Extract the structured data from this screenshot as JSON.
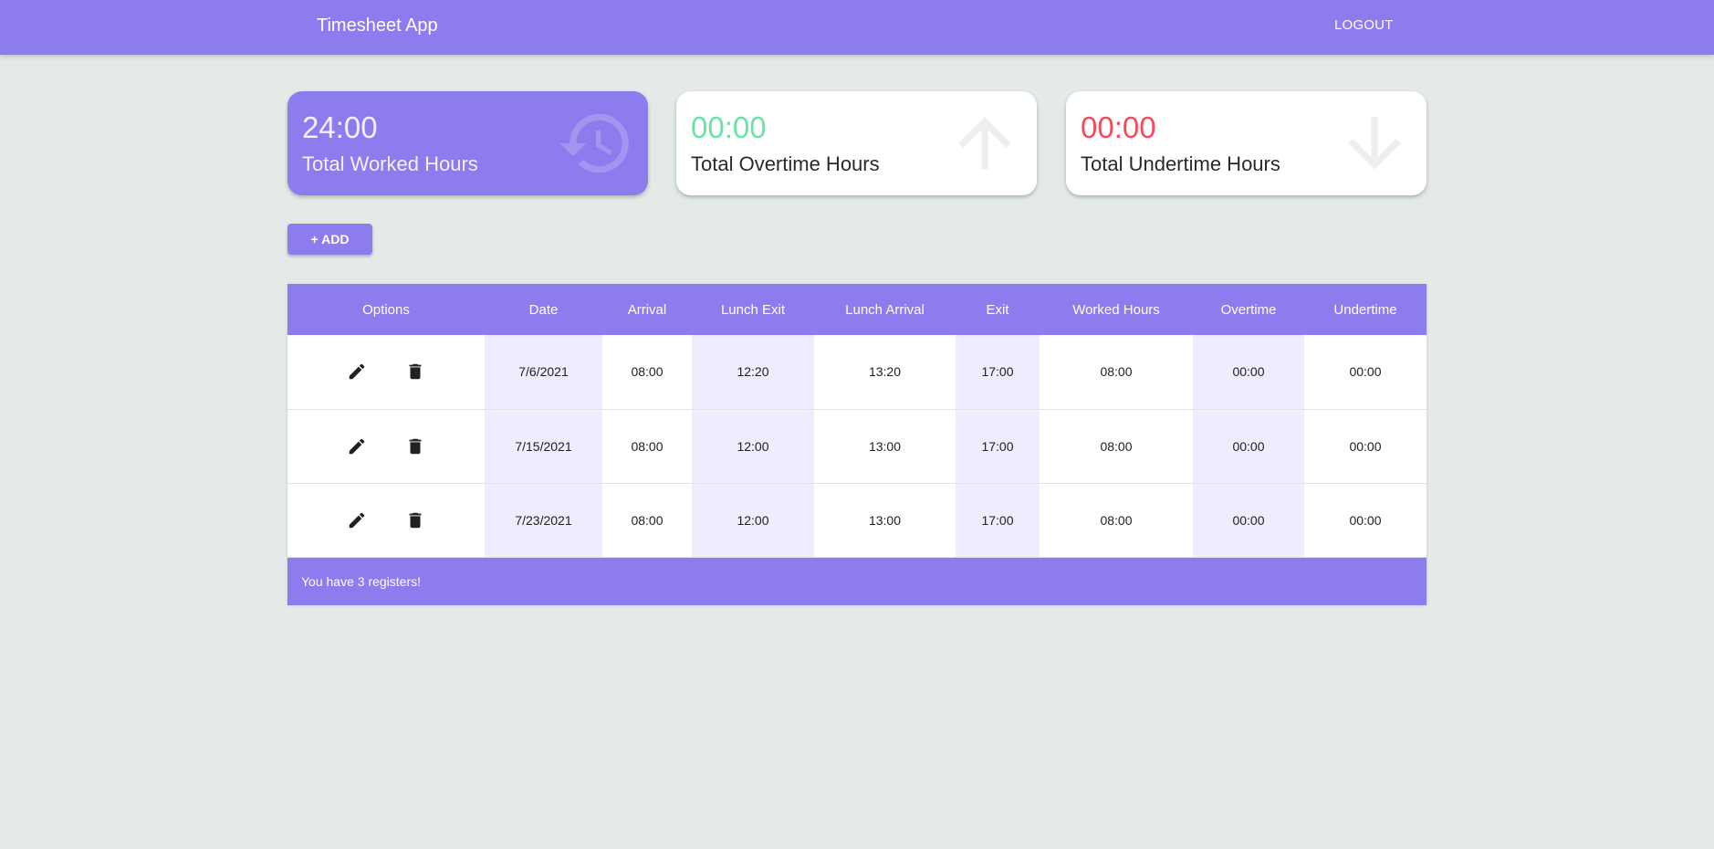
{
  "header": {
    "title": "Timesheet App",
    "logout_label": "LOGOUT"
  },
  "cards": {
    "worked": {
      "value": "24:00",
      "label": "Total Worked Hours",
      "icon": "history-icon"
    },
    "overtime": {
      "value": "00:00",
      "label": "Total Overtime Hours",
      "icon": "arrow-up-icon"
    },
    "undertime": {
      "value": "00:00",
      "label": "Total Undertime Hours",
      "icon": "arrow-down-icon"
    }
  },
  "add_button": {
    "label": "+ ADD"
  },
  "table": {
    "headers": [
      "Options",
      "Date",
      "Arrival",
      "Lunch Exit",
      "Lunch Arrival",
      "Exit",
      "Worked Hours",
      "Overtime",
      "Undertime"
    ],
    "rows": [
      {
        "date": "7/6/2021",
        "arrival": "08:00",
        "lunch_exit": "12:20",
        "lunch_arrival": "13:20",
        "exit": "17:00",
        "worked": "08:00",
        "overtime": "00:00",
        "undertime": "00:00"
      },
      {
        "date": "7/15/2021",
        "arrival": "08:00",
        "lunch_exit": "12:00",
        "lunch_arrival": "13:00",
        "exit": "17:00",
        "worked": "08:00",
        "overtime": "00:00",
        "undertime": "00:00"
      },
      {
        "date": "7/23/2021",
        "arrival": "08:00",
        "lunch_exit": "12:00",
        "lunch_arrival": "13:00",
        "exit": "17:00",
        "worked": "08:00",
        "overtime": "00:00",
        "undertime": "00:00"
      }
    ],
    "footer": "You have 3 registers!"
  },
  "colors": {
    "primary": "#8c7cee",
    "background": "#e4eae7",
    "overtime": "#69e3a6",
    "undertime": "#f24c5c",
    "column_shade": "#eeecfd"
  }
}
